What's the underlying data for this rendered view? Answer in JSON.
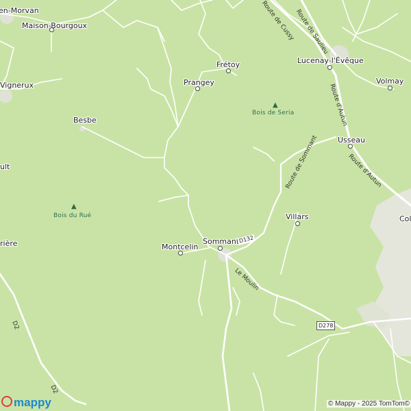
{
  "map": {
    "places": [
      {
        "id": "morvan",
        "name": "en-Morvan"
      },
      {
        "id": "maison-bourgoux",
        "name": "Maison-Bourgoux"
      },
      {
        "id": "vignerux",
        "name": "Vignerux"
      },
      {
        "id": "ult",
        "name": "ult"
      },
      {
        "id": "riere",
        "name": "rière"
      },
      {
        "id": "besbe",
        "name": "Besbe"
      },
      {
        "id": "pranget",
        "name": "Prangey"
      },
      {
        "id": "fretoy",
        "name": "Frétoy"
      },
      {
        "id": "lucenay",
        "name": "Lucenay-l'Évêque"
      },
      {
        "id": "volmay",
        "name": "Volmay"
      },
      {
        "id": "usseau",
        "name": "Usseau"
      },
      {
        "id": "villars",
        "name": "Villars"
      },
      {
        "id": "sommant",
        "name": "Sommant"
      },
      {
        "id": "montcelin",
        "name": "Montcelin"
      },
      {
        "id": "col",
        "name": "Col"
      }
    ],
    "forests": [
      {
        "id": "seria",
        "name": "Bois de Seria"
      },
      {
        "id": "rue",
        "name": "Bois du Rué"
      }
    ],
    "road_names": [
      {
        "id": "cussy",
        "name": "Route de Cussy"
      },
      {
        "id": "saulieu",
        "name": "Route de Saulieu"
      },
      {
        "id": "autun1",
        "name": "Route d'Autun"
      },
      {
        "id": "autun2",
        "name": "Route d'Autun"
      },
      {
        "id": "sommant-route",
        "name": "Route de Sommant"
      },
      {
        "id": "moulin",
        "name": "Le Moulin"
      }
    ],
    "road_refs": [
      {
        "id": "d132",
        "name": "D132"
      },
      {
        "id": "d278",
        "name": "D278"
      },
      {
        "id": "d2a",
        "name": "D2"
      },
      {
        "id": "d2b",
        "name": "D2"
      }
    ],
    "colors": {
      "land": "#c9e3a6",
      "urban": "#e4e6dc",
      "road": "#ffffff",
      "forest_text": "#2d6b45"
    }
  },
  "branding": {
    "logo": "mappy",
    "copyright": "© Mappy - 2025 TomTom©"
  }
}
